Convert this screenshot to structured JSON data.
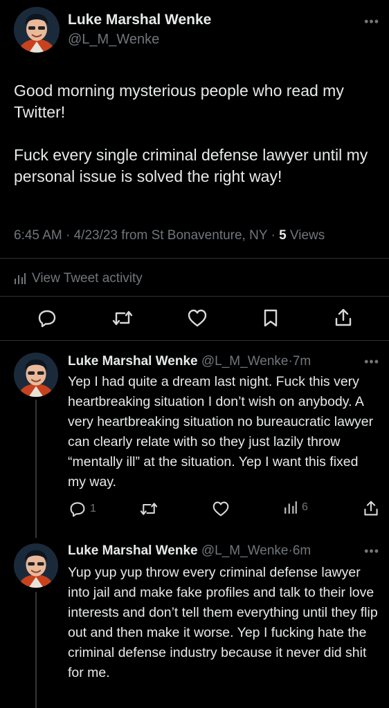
{
  "main_tweet": {
    "display_name": "Luke Marshal Wenke",
    "handle": "@L_M_Wenke",
    "more_label": "•••",
    "text": "Good morning mysterious people who read my Twitter!\n\nFuck every single criminal defense lawyer until my personal issue is solved the right way!",
    "time": "6:45 AM",
    "date": "4/23/23",
    "location": "from St Bonaventure, NY",
    "views_count": "5",
    "views_label": "Views",
    "activity_label": "View Tweet activity",
    "actions": [
      "reply-icon",
      "retweet-icon",
      "like-icon",
      "bookmark-icon",
      "share-icon"
    ]
  },
  "replies": [
    {
      "display_name": "Luke Marshal Wenke",
      "handle": "@L_M_Wenke",
      "age": "7m",
      "more_label": "•••",
      "text": "Yep I had quite a dream last night.  Fuck this very heartbreaking situation I don’t wish on anybody.  A very heartbreaking situation no bureaucratic lawyer can clearly relate with so they just lazily throw “mentally ill” at the situation.  Yep I want this fixed my way.",
      "reply_count": "1",
      "views_count": "6"
    },
    {
      "display_name": "Luke Marshal Wenke",
      "handle": "@L_M_Wenke",
      "age": "6m",
      "more_label": "•••",
      "text": "Yup yup yup throw every criminal defense lawyer into jail and make fake profiles and talk to their love interests and don’t tell them everything until they flip out and then make it worse.  Yep I fucking hate the criminal defense industry because it never did shit for me."
    }
  ],
  "colors": {
    "background": "#000000",
    "text": "#e7e9ea",
    "secondary": "#71767b",
    "divider": "#2f3336"
  }
}
